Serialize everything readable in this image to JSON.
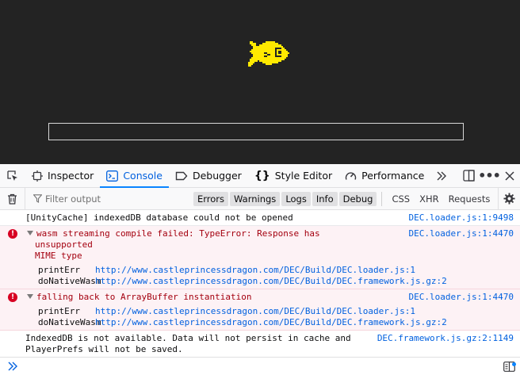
{
  "toolbar": {
    "tabs": [
      {
        "label": "Inspector",
        "icon": "inspector-icon"
      },
      {
        "label": "Console",
        "icon": "console-icon",
        "selected": true
      },
      {
        "label": "Debugger",
        "icon": "debugger-icon"
      },
      {
        "label": "Style Editor",
        "icon": "braces-icon"
      },
      {
        "label": "Performance",
        "icon": "gauge-icon"
      }
    ]
  },
  "filterbar": {
    "placeholder": "Filter output",
    "levels": [
      "Errors",
      "Warnings",
      "Logs",
      "Info",
      "Debug"
    ],
    "requests": [
      "CSS",
      "XHR",
      "Requests"
    ]
  },
  "messages": [
    {
      "type": "log",
      "text": "[UnityCache] indexedDB database could not be opened",
      "location": "DEC.loader.js:1:9498"
    },
    {
      "type": "error",
      "text": "wasm streaming compile failed: TypeError: Response has unsupported\nMIME type",
      "location": "DEC.loader.js:1:4470",
      "frames": [
        {
          "fn": "printErr",
          "url": "http://www.castleprincessdragon.com/DEC/Build/DEC.loader.js:1"
        },
        {
          "fn": "doNativeWasm",
          "url": "http://www.castleprincessdragon.com/DEC/Build/DEC.framework.js.gz:2"
        }
      ]
    },
    {
      "type": "error",
      "text": "falling back to ArrayBuffer instantiation",
      "location": "DEC.loader.js:1:4470",
      "frames": [
        {
          "fn": "printErr",
          "url": "http://www.castleprincessdragon.com/DEC/Build/DEC.loader.js:1"
        },
        {
          "fn": "doNativeWasm",
          "url": "http://www.castleprincessdragon.com/DEC/Build/DEC.framework.js.gz:2"
        }
      ]
    },
    {
      "type": "log",
      "text": "IndexedDB is not available. Data will not persist in cache and\nPlayerPrefs will not be saved.",
      "location": "DEC.framework.js.gz:2:1149"
    }
  ],
  "colors": {
    "game_bg": "#232323",
    "fish": "#ffe900",
    "accent": "#0a84ff",
    "error_text": "#a4000f",
    "error_bg": "#fdf2f5",
    "link": "#0060df"
  }
}
